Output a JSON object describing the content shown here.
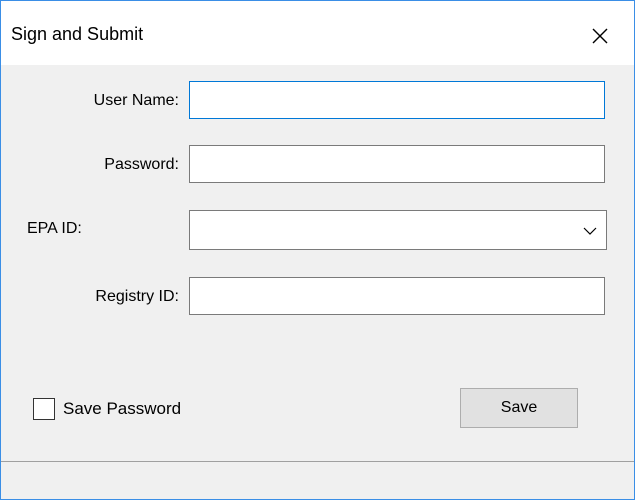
{
  "window": {
    "title": "Sign and Submit"
  },
  "form": {
    "user_name_label": "User Name:",
    "user_name_value": "",
    "password_label": "Password:",
    "password_value": "",
    "epa_id_label": "EPA ID:",
    "epa_id_selected": "",
    "registry_id_label": "Registry ID:",
    "registry_id_value": ""
  },
  "options": {
    "save_password_label": "Save Password",
    "save_password_checked": false
  },
  "actions": {
    "save_label": "Save"
  },
  "icons": {
    "close": "close-icon",
    "dropdown": "chevron-down-icon"
  },
  "colors": {
    "accent": "#0078d7",
    "window_border": "#3a8ee6",
    "dialog_background": "#f0f0f0"
  }
}
